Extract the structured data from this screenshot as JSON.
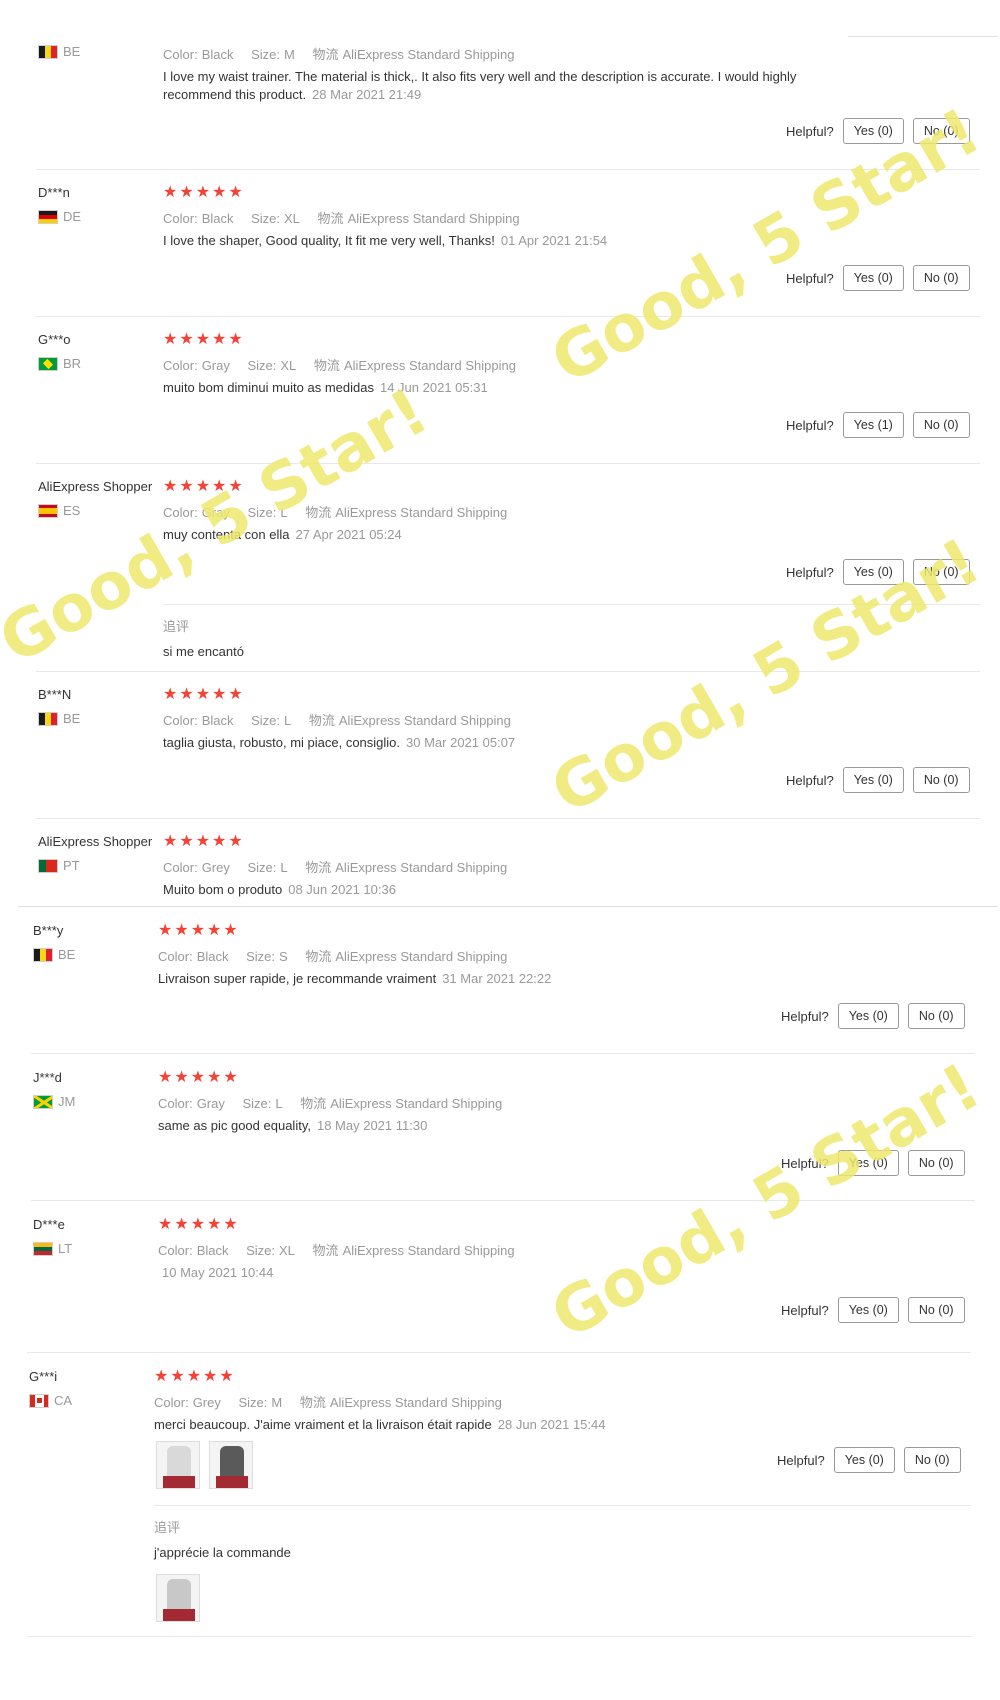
{
  "labels": {
    "helpful": "Helpful?",
    "color_key": "Color:",
    "size_key": "Size:",
    "logistics_key": "物流",
    "followup": "追评"
  },
  "reviews": [
    {
      "name": "",
      "country": "BE",
      "stars": "★★★★★",
      "color": "Black",
      "size": "M",
      "shipping": "AliExpress Standard Shipping",
      "comment": "I love my waist trainer. The material is thick,. It also fits very well and the description is accurate. I would highly recommend this product.",
      "date": "28 Mar 2021 21:49",
      "yes": "Yes (0)",
      "no": "No (0)"
    },
    {
      "name": "D***n",
      "country": "DE",
      "stars": "★★★★★",
      "color": "Black",
      "size": "XL",
      "shipping": "AliExpress Standard Shipping",
      "comment": "I love the shaper, Good quality, It fit me very well, Thanks!",
      "date": "01 Apr 2021 21:54",
      "yes": "Yes (0)",
      "no": "No (0)"
    },
    {
      "name": "G***o",
      "country": "BR",
      "stars": "★★★★★",
      "color": "Gray",
      "size": "XL",
      "shipping": "AliExpress Standard Shipping",
      "comment": "muito bom diminui muito as medidas",
      "date": "14 Jun 2021 05:31",
      "yes": "Yes (1)",
      "no": "No (0)"
    },
    {
      "name": "AliExpress Shopper",
      "country": "ES",
      "stars": "★★★★★",
      "color": "Gray",
      "size": "L",
      "shipping": "AliExpress Standard Shipping",
      "comment": "muy contenta con ella",
      "date": "27 Apr 2021 05:24",
      "yes": "Yes (0)",
      "no": "No (0)",
      "followup": "si me encantó"
    },
    {
      "name": "B***N",
      "country": "BE",
      "stars": "★★★★★",
      "color": "Black",
      "size": "L",
      "shipping": "AliExpress Standard Shipping",
      "comment": "taglia giusta, robusto, mi piace, consiglio.",
      "date": "30 Mar 2021 05:07",
      "yes": "Yes (0)",
      "no": "No (0)"
    },
    {
      "name": "AliExpress Shopper",
      "country": "PT",
      "stars": "★★★★★",
      "color": "Grey",
      "size": "L",
      "shipping": "AliExpress Standard Shipping",
      "comment": "Muito bom o produto",
      "date": "08 Jun 2021 10:36"
    },
    {
      "name": "B***y",
      "country": "BE",
      "stars": "★★★★★",
      "color": "Black",
      "size": "S",
      "shipping": "AliExpress Standard Shipping",
      "comment": "Livraison super rapide, je recommande vraiment",
      "date": "31 Mar 2021 22:22",
      "yes": "Yes (0)",
      "no": "No (0)"
    },
    {
      "name": "J***d",
      "country": "JM",
      "stars": "★★★★★",
      "color": "Gray",
      "size": "L",
      "shipping": "AliExpress Standard Shipping",
      "comment": "same as pic good equality,",
      "date": "18 May 2021 11:30",
      "yes": "Yes (0)",
      "no": "No (0)"
    },
    {
      "name": "D***e",
      "country": "LT",
      "stars": "★★★★★",
      "color": "Black",
      "size": "XL",
      "shipping": "AliExpress Standard Shipping",
      "comment": "",
      "date": "10 May 2021 10:44",
      "yes": "Yes (0)",
      "no": "No (0)"
    },
    {
      "name": "G***i",
      "country": "CA",
      "stars": "★★★★★",
      "color": "Grey",
      "size": "M",
      "shipping": "AliExpress Standard Shipping",
      "comment": "merci beaucoup. J'aime vraiment et la livraison était rapide",
      "date": "28 Jun 2021 15:44",
      "yes": "Yes (0)",
      "no": "No (0)",
      "followup": "j'apprécie la commande"
    }
  ],
  "watermark": "Good, 5 Star!",
  "colors": {
    "star": "#f44336",
    "watermark": "#eee86e",
    "muted": "#999999"
  }
}
